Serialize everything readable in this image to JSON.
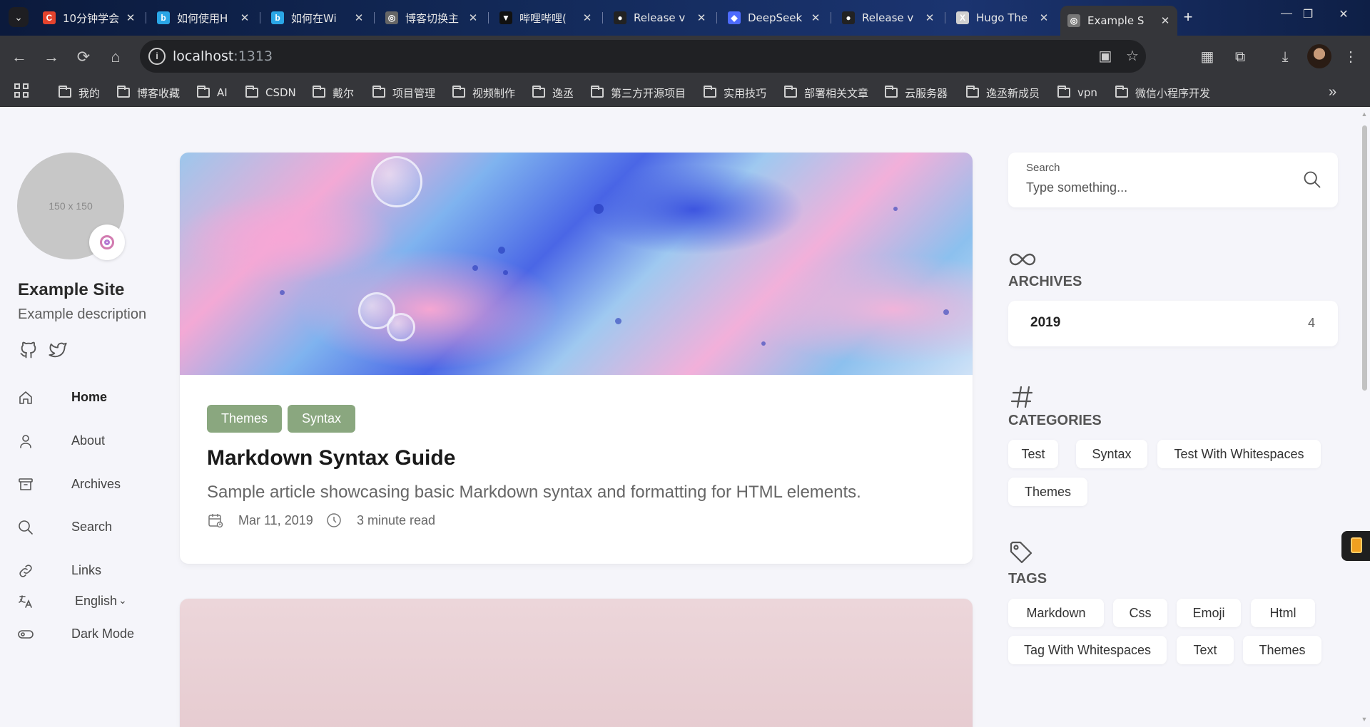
{
  "browser": {
    "tabs": [
      {
        "title": "10分钟学会",
        "favicon": "csdn",
        "color": "#e4432d",
        "glyph": "C"
      },
      {
        "title": "如何使用H",
        "favicon": "bilibili",
        "color": "#2aa6e6",
        "glyph": "b"
      },
      {
        "title": "如何在Wi",
        "favicon": "bilibili",
        "color": "#2aa6e6",
        "glyph": "b"
      },
      {
        "title": "博客切换主",
        "favicon": "globe",
        "color": "#666666",
        "glyph": "◎"
      },
      {
        "title": "哔哩哔哩(",
        "favicon": "bilibili-tv",
        "color": "#111111",
        "glyph": "▼"
      },
      {
        "title": "Release v",
        "favicon": "github",
        "color": "#222222",
        "glyph": "●"
      },
      {
        "title": "DeepSeek",
        "favicon": "deepseek",
        "color": "#4d6bfe",
        "glyph": "◆"
      },
      {
        "title": "Release v",
        "favicon": "github",
        "color": "#222222",
        "glyph": "●"
      },
      {
        "title": "Hugo The",
        "favicon": "hugo",
        "color": "#d0d0d0",
        "glyph": "X"
      },
      {
        "title": "Example S",
        "favicon": "globe",
        "color": "#777777",
        "glyph": "◎",
        "active": true
      }
    ],
    "close_glyph": "✕",
    "new_tab_glyph": "+",
    "url_host": "localhost",
    "url_port": ":1313",
    "bookmarks": [
      "我的",
      "博客收藏",
      "AI",
      "CSDN",
      "戴尔",
      "项目管理",
      "视频制作",
      "逸丞",
      "第三方开源项目",
      "实用技巧",
      "部署相关文章",
      "云服务器",
      "逸丞新成员",
      "vpn",
      "微信小程序开发"
    ]
  },
  "profile": {
    "avatar_placeholder": "150 x 150",
    "site_name": "Example Site",
    "site_description": "Example description"
  },
  "menu": [
    {
      "label": "Home",
      "icon": "home-icon",
      "active": true
    },
    {
      "label": "About",
      "icon": "user-icon"
    },
    {
      "label": "Archives",
      "icon": "archive-icon"
    },
    {
      "label": "Search",
      "icon": "search-icon"
    },
    {
      "label": "Links",
      "icon": "link-icon"
    }
  ],
  "language": {
    "label": "English"
  },
  "dark_mode": {
    "label": "Dark Mode"
  },
  "post": {
    "categories": [
      "Themes",
      "Syntax"
    ],
    "title": "Markdown Syntax Guide",
    "subtitle": "Sample article showcasing basic Markdown syntax and formatting for HTML elements.",
    "date": "Mar 11, 2019",
    "read_time": "3 minute read"
  },
  "search": {
    "label": "Search",
    "placeholder": "Type something..."
  },
  "archives": {
    "title": "ARCHIVES",
    "year": "2019",
    "count": "4"
  },
  "categories": {
    "title": "CATEGORIES",
    "items": [
      "Test",
      "Syntax",
      "Test With Whitespaces",
      "Themes"
    ]
  },
  "tags": {
    "title": "TAGS",
    "items": [
      "Markdown",
      "Css",
      "Emoji",
      "Html",
      "Tag With Whitespaces",
      "Text",
      "Themes"
    ]
  },
  "colors": {
    "chip_accent": "#8aa77f",
    "page_bg": "#f5f5fa"
  }
}
